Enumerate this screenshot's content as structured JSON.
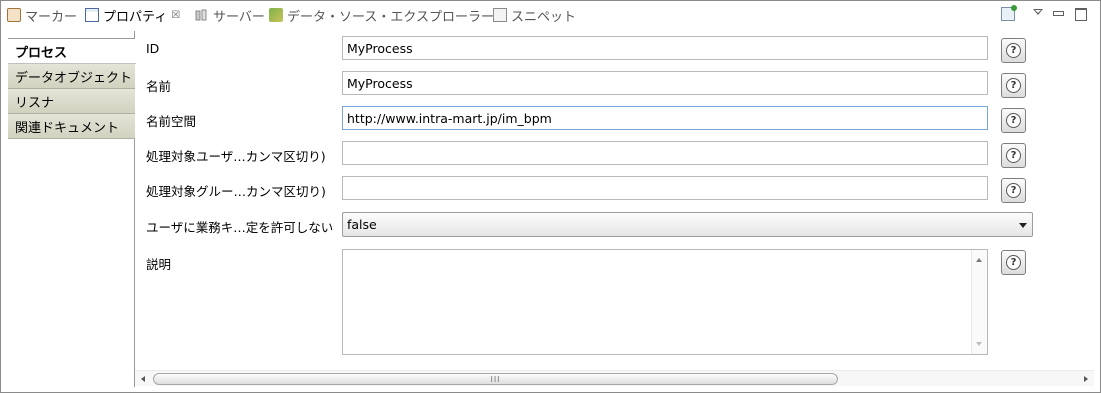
{
  "tabs": [
    {
      "label": "マーカー",
      "icon": "marker-icon"
    },
    {
      "label": "プロパティ",
      "icon": "properties-icon",
      "active": true,
      "close": "☒"
    },
    {
      "label": "サーバー",
      "icon": "server-icon"
    },
    {
      "label": "データ・ソース・エクスプローラー",
      "icon": "data-source-icon"
    },
    {
      "label": "スニペット",
      "icon": "snippet-icon"
    }
  ],
  "sidetabs": [
    {
      "label": "プロセス",
      "active": true
    },
    {
      "label": "データオブジェクト"
    },
    {
      "label": "リスナ"
    },
    {
      "label": "関連ドキュメント"
    }
  ],
  "properties": {
    "id": {
      "label": "ID",
      "value": "MyProcess"
    },
    "name": {
      "label": "名前",
      "value": "MyProcess"
    },
    "namespace": {
      "label": "名前空間",
      "value": "http://www.intra-mart.jp/im_bpm"
    },
    "target_users": {
      "label": "処理対象ユーザ…カンマ区切り)",
      "value": ""
    },
    "target_groups": {
      "label": "処理対象グルー…カンマ区切り)",
      "value": ""
    },
    "business_key": {
      "label": "ユーザに業務キ…定を許可しない",
      "value": "false"
    },
    "description": {
      "label": "説明",
      "value": ""
    }
  },
  "help_symbol": "?",
  "scroll_grip": "III",
  "colors": {
    "sidetab_bg": "#d2d2c0",
    "focus_border": "#7aa7d6"
  }
}
